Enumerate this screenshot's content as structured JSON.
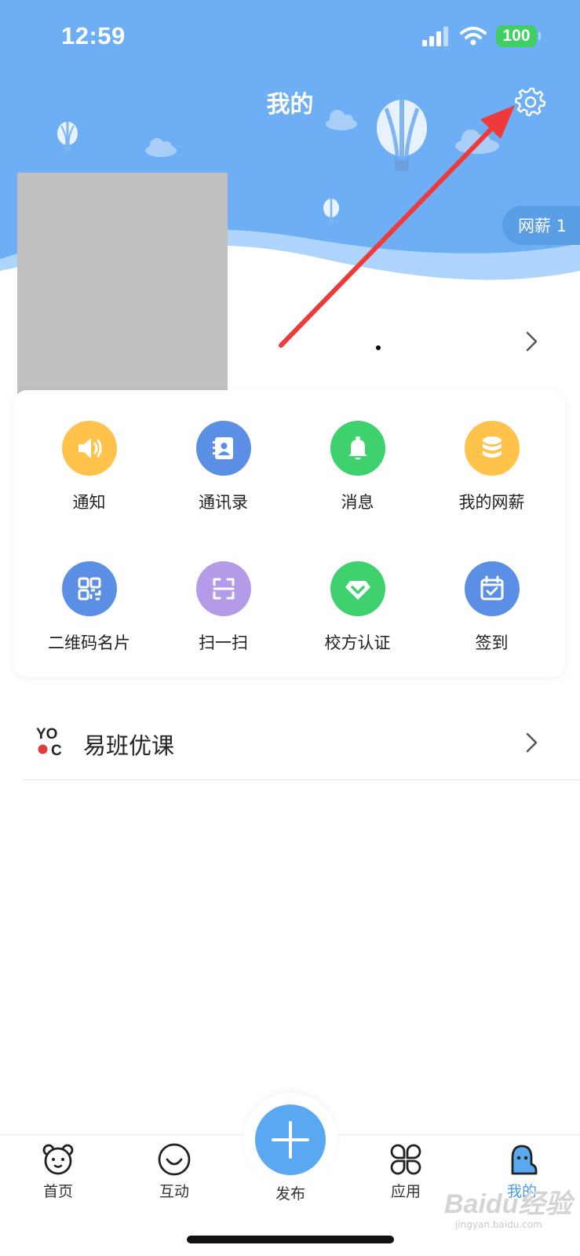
{
  "status_bar": {
    "time": "12:59",
    "battery": "100"
  },
  "header": {
    "title": "我的",
    "coin_pill": "网薪 1"
  },
  "menu": {
    "items": [
      {
        "label": "通知",
        "icon": "speaker-icon",
        "color": "#ffc24a"
      },
      {
        "label": "通讯录",
        "icon": "contacts-book-icon",
        "color": "#5b8fe6"
      },
      {
        "label": "消息",
        "icon": "bell-icon",
        "color": "#3fd16e"
      },
      {
        "label": "我的网薪",
        "icon": "coin-stack-icon",
        "color": "#ffc24a"
      },
      {
        "label": "二维码名片",
        "icon": "qr-code-icon",
        "color": "#5b8fe6"
      },
      {
        "label": "扫一扫",
        "icon": "scan-icon",
        "color": "#b49be8"
      },
      {
        "label": "校方认证",
        "icon": "diamond-check-icon",
        "color": "#3fd16e"
      },
      {
        "label": "签到",
        "icon": "calendar-check-icon",
        "color": "#5b8fe6"
      }
    ]
  },
  "course": {
    "label": "易班优课",
    "logo_top": "YO",
    "logo_bottom": "C"
  },
  "tabs": [
    {
      "label": "首页",
      "icon": "bear-face-icon"
    },
    {
      "label": "互动",
      "icon": "smile-face-icon"
    },
    {
      "label": "发布",
      "icon": "plus-icon"
    },
    {
      "label": "应用",
      "icon": "clover-grid-icon"
    },
    {
      "label": "我的",
      "icon": "person-blob-icon",
      "active": true
    }
  ],
  "watermark": {
    "main": "Baidu经验",
    "sub": "jingyan.baidu.com"
  },
  "colors": {
    "header_blue": "#6eaef4",
    "accent": "#4a9be8",
    "arrow": "#ee3a3a"
  }
}
